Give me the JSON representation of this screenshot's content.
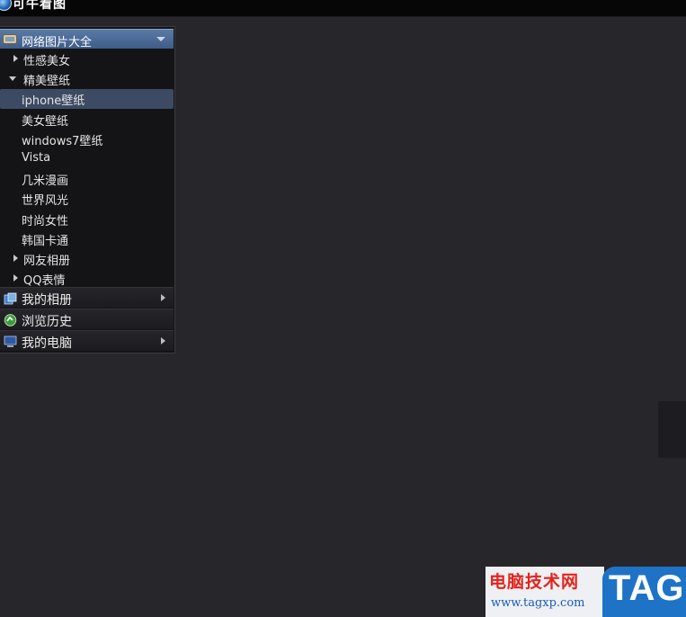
{
  "app": {
    "title": "可牛看图"
  },
  "sidebar": {
    "group": {
      "label": "网络图片大全",
      "icon": "picture-folder-icon"
    },
    "tree": [
      {
        "label": "性感美女",
        "expander": "collapsed",
        "indent": 1,
        "name": "tree-item-sexy-beauty"
      },
      {
        "label": "精美壁纸",
        "expander": "expanded",
        "indent": 1,
        "name": "tree-item-wallpapers"
      },
      {
        "label": "iphone壁纸",
        "expander": "none",
        "indent": 2,
        "selected": true,
        "name": "tree-item-iphone-wallpaper"
      },
      {
        "label": "美女壁纸",
        "expander": "none",
        "indent": 2,
        "name": "tree-item-beauty-wallpaper"
      },
      {
        "label": "windows7壁纸",
        "expander": "none",
        "indent": 2,
        "name": "tree-item-windows7-wallpaper"
      },
      {
        "label": "Vista",
        "expander": "none",
        "indent": 2,
        "name": "tree-item-vista"
      },
      {
        "label": "几米漫画",
        "expander": "none",
        "indent": 2,
        "name": "tree-item-jimmy-comics"
      },
      {
        "label": "世界风光",
        "expander": "none",
        "indent": 2,
        "name": "tree-item-world-scenery"
      },
      {
        "label": "时尚女性",
        "expander": "none",
        "indent": 2,
        "name": "tree-item-fashion-women"
      },
      {
        "label": "韩国卡通",
        "expander": "none",
        "indent": 2,
        "name": "tree-item-korean-cartoon"
      },
      {
        "label": "网友相册",
        "expander": "collapsed",
        "indent": 1,
        "name": "tree-item-user-albums"
      },
      {
        "label": "QQ表情",
        "expander": "collapsed",
        "indent": 1,
        "name": "tree-item-qq-emoticons"
      }
    ],
    "nav": [
      {
        "label": "我的相册",
        "icon": "album-icon",
        "has_arrow": true,
        "name": "nav-my-albums"
      },
      {
        "label": "浏览历史",
        "icon": "history-icon",
        "has_arrow": false,
        "name": "nav-browse-history"
      },
      {
        "label": "我的电脑",
        "icon": "computer-icon",
        "has_arrow": true,
        "name": "nav-my-computer"
      }
    ]
  },
  "watermark": {
    "site_name": "电脑技术网",
    "url": "www.tagxp.com",
    "tag": "TAG"
  },
  "colors": {
    "background": "#27262b",
    "selected_row": "#3c4b63",
    "header_blue": "#4a6a96",
    "watermark_red": "#e4231d",
    "watermark_blue": "#1f73c7"
  }
}
